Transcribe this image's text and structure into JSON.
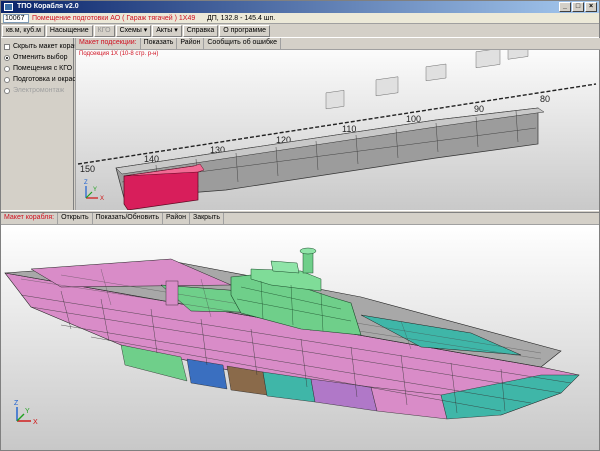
{
  "window": {
    "title": "ТПО Корабля v2.0",
    "buttons": [
      "_",
      "□",
      "×"
    ]
  },
  "infobar": {
    "id": "10067",
    "room": "Помещение подготовки АО ( Гараж тягачей ) 1Х49",
    "dims": "ДП, 132.8 - 145.4 шп."
  },
  "mainmenu": {
    "items": [
      {
        "label": "кв.м, куб.м",
        "disabled": false
      },
      {
        "label": "Насыщение",
        "disabled": false
      },
      {
        "label": "КГО",
        "disabled": true
      },
      {
        "label": "Схемы ▾",
        "disabled": false
      },
      {
        "label": "Акты ▾",
        "disabled": false
      },
      {
        "label": "Справка",
        "disabled": false
      },
      {
        "label": "О программе",
        "disabled": false
      }
    ]
  },
  "left_panel": {
    "checkbox": "Скрыть макет корабля",
    "radios": [
      {
        "label": "Отменить выбор",
        "selected": true,
        "disabled": false
      },
      {
        "label": "Помещения с КГО",
        "selected": false,
        "disabled": false
      },
      {
        "label": "Подготовка и окраска",
        "selected": false,
        "disabled": false
      },
      {
        "label": "Электромонтаж",
        "selected": false,
        "disabled": true
      }
    ]
  },
  "top_view": {
    "toolbar": {
      "active_label": "Макет подсекции:",
      "buttons": [
        "Показать",
        "Район",
        "Сообщить об ошибке"
      ]
    },
    "subtitle": "Подсекция 1Х (10-8 стр. р-н)",
    "scale": [
      "150",
      "140",
      "130",
      "120",
      "110",
      "100",
      "90",
      "80"
    ]
  },
  "bottom_view": {
    "toolbar": {
      "active_label": "Макет корабля:",
      "buttons": [
        "Открыть",
        "Показать/Обновить",
        "Район",
        "Закрыть"
      ]
    }
  },
  "axes": {
    "x": "X",
    "y": "Y",
    "z": "Z"
  },
  "colors": {
    "highlight_room": "#d81e5b",
    "ship_section_gray": "#a8a8a8",
    "teal": "#3fb6a8",
    "pink": "#d98cc8",
    "green": "#6fcf8a",
    "blue": "#3a6fc0",
    "brown": "#8a6a4a"
  }
}
